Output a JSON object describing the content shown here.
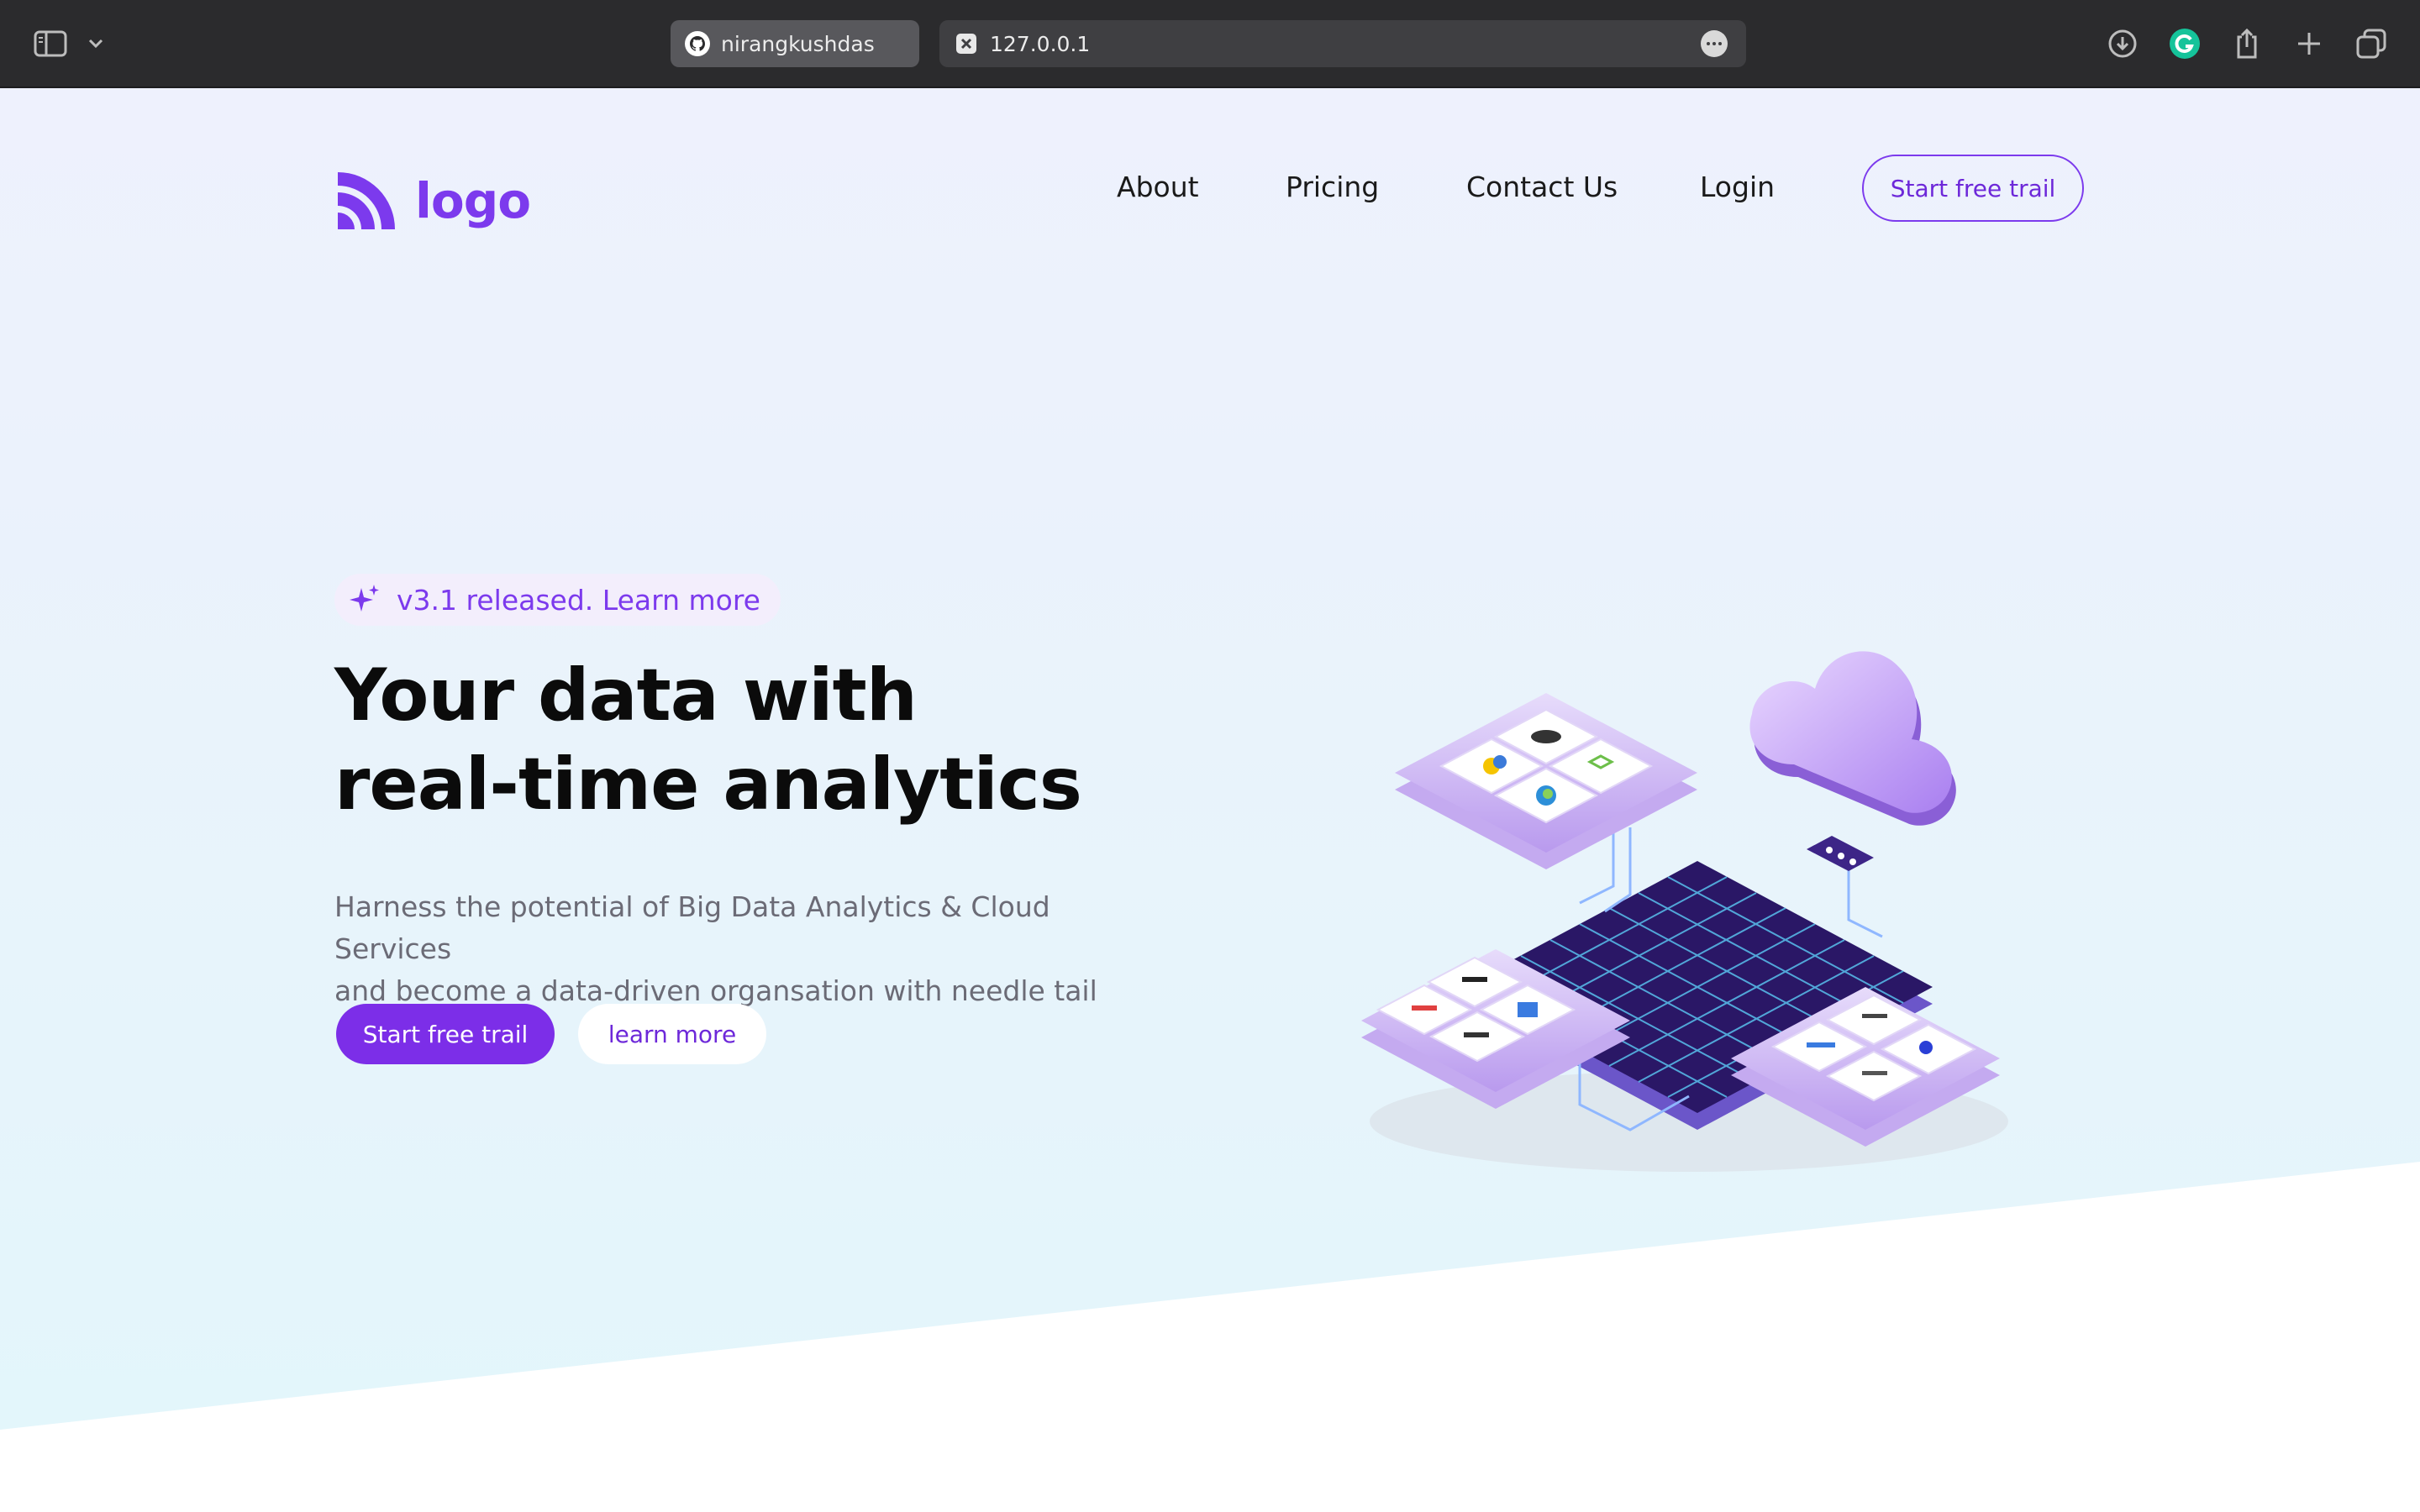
{
  "browser": {
    "tabs": [
      {
        "label": "nirangkushdas",
        "icon": "github-icon"
      },
      {
        "label": "127.0.0.1",
        "icon": "close-tab-icon"
      }
    ],
    "toolbar_icons": [
      "sidebar-icon",
      "chevron-down-icon",
      "download-icon",
      "grammarly-icon",
      "share-icon",
      "new-tab-icon",
      "tab-overview-icon"
    ]
  },
  "header": {
    "logo_text": "logo",
    "nav": [
      {
        "label": "About"
      },
      {
        "label": "Pricing"
      },
      {
        "label": "Contact Us"
      },
      {
        "label": "Login"
      }
    ],
    "cta_label": "Start free trail"
  },
  "hero": {
    "badge_text": "v3.1 released. Learn more",
    "headline_line1": "Your data with",
    "headline_line2": "real-time analytics",
    "subtitle_line1": "Harness the potential of Big Data Analytics & Cloud Services",
    "subtitle_line2": "and become a data-driven organsation with needle tail",
    "primary_cta": "Start free trail",
    "secondary_cta": "learn more"
  },
  "colors": {
    "brand": "#7c3aed",
    "primary_button": "#7c2ee8",
    "chrome_bg": "#2b2b2d",
    "page_bg_top": "#eef1fd",
    "page_bg_bottom": "#e2f6fb"
  }
}
